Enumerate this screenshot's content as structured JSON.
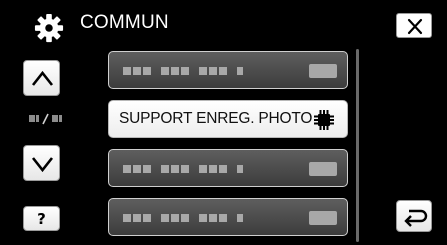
{
  "header": {
    "title": "COMMUN",
    "icon": "gear-icon"
  },
  "buttons": {
    "close": "close-icon",
    "up": "chevron-up-icon",
    "down": "chevron-down-icon",
    "help_label": "?",
    "back": "back-icon"
  },
  "menu": {
    "items": [
      {
        "label": "",
        "disabled": true
      },
      {
        "label": "SUPPORT ENREG. PHOTO",
        "selected": true,
        "icon": "memory-chip-icon"
      },
      {
        "label": "",
        "disabled": true
      },
      {
        "label": "",
        "disabled": true
      }
    ]
  }
}
